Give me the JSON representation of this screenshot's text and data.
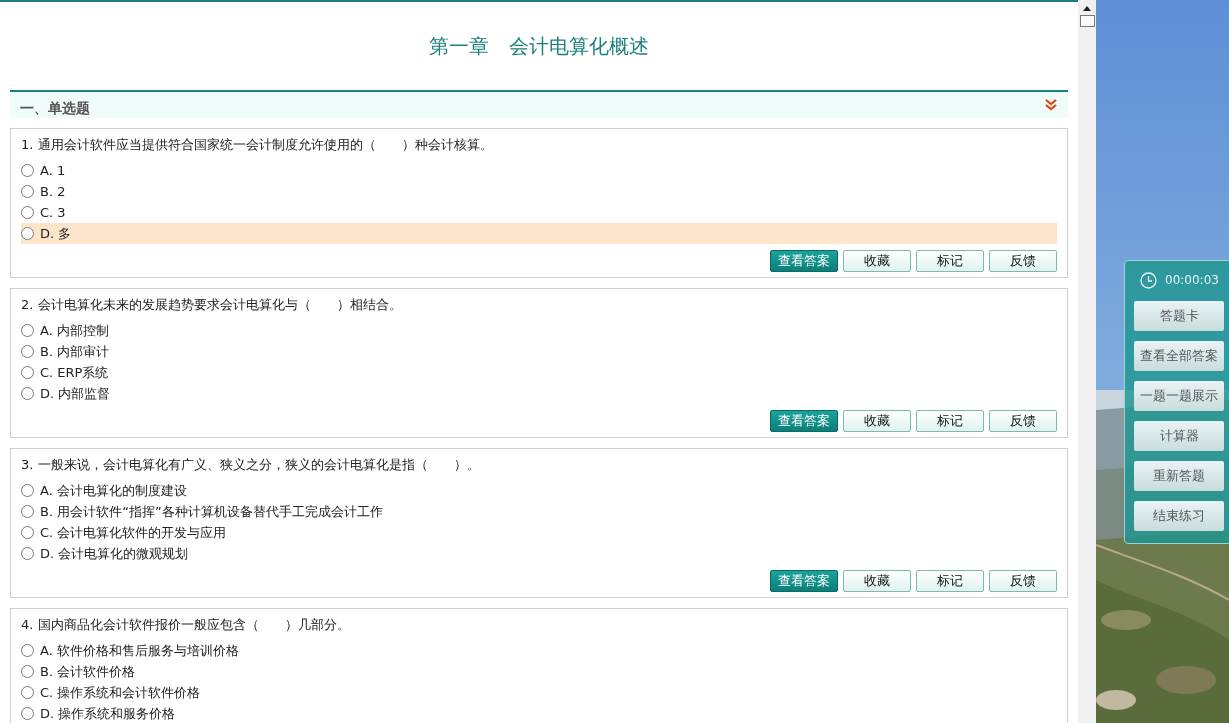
{
  "title": "第一章　会计电算化概述",
  "section": {
    "label": "一、单选题"
  },
  "questions": [
    {
      "text": "1. 通用会计软件应当提供符合国家统一会计制度允许使用的（　　）种会计核算。",
      "options": [
        {
          "label": "A. 1",
          "selected": false,
          "highlighted": false
        },
        {
          "label": "B. 2",
          "selected": false,
          "highlighted": false
        },
        {
          "label": "C. 3",
          "selected": false,
          "highlighted": false
        },
        {
          "label": "D. 多",
          "selected": false,
          "highlighted": true
        }
      ],
      "buttons": [
        {
          "label": "查看答案",
          "primary": true
        },
        {
          "label": "收藏",
          "primary": false
        },
        {
          "label": "标记",
          "primary": false
        },
        {
          "label": "反馈",
          "primary": false
        }
      ]
    },
    {
      "text": "2. 会计电算化未来的发展趋势要求会计电算化与（　　）相结合。",
      "options": [
        {
          "label": "A. 内部控制",
          "selected": false,
          "highlighted": false
        },
        {
          "label": "B. 内部审计",
          "selected": false,
          "highlighted": false
        },
        {
          "label": "C. ERP系统",
          "selected": false,
          "highlighted": false
        },
        {
          "label": "D. 内部监督",
          "selected": false,
          "highlighted": false
        }
      ],
      "buttons": [
        {
          "label": "查看答案",
          "primary": true
        },
        {
          "label": "收藏",
          "primary": false
        },
        {
          "label": "标记",
          "primary": false
        },
        {
          "label": "反馈",
          "primary": false
        }
      ]
    },
    {
      "text": "3. 一般来说，会计电算化有广义、狭义之分，狭义的会计电算化是指（　　）。",
      "options": [
        {
          "label": "A. 会计电算化的制度建设",
          "selected": false,
          "highlighted": false
        },
        {
          "label": "B. 用会计软件“指挥”各种计算机设备替代手工完成会计工作",
          "selected": false,
          "highlighted": false
        },
        {
          "label": "C. 会计电算化软件的开发与应用",
          "selected": false,
          "highlighted": false
        },
        {
          "label": "D. 会计电算化的微观规划",
          "selected": false,
          "highlighted": false
        }
      ],
      "buttons": [
        {
          "label": "查看答案",
          "primary": true
        },
        {
          "label": "收藏",
          "primary": false
        },
        {
          "label": "标记",
          "primary": false
        },
        {
          "label": "反馈",
          "primary": false
        }
      ]
    },
    {
      "text": "4. 国内商品化会计软件报价一般应包含（　　）几部分。",
      "options": [
        {
          "label": "A. 软件价格和售后服务与培训价格",
          "selected": false,
          "highlighted": false
        },
        {
          "label": "B. 会计软件价格",
          "selected": false,
          "highlighted": false
        },
        {
          "label": "C. 操作系统和会计软件价格",
          "selected": false,
          "highlighted": false
        },
        {
          "label": "D. 操作系统和服务价格",
          "selected": false,
          "highlighted": false
        }
      ]
    }
  ],
  "side_panel": {
    "timer": "00:00:03",
    "buttons": [
      "答题卡",
      "查看全部答案",
      "一题一题展示",
      "计算器",
      "重新答题",
      "结束练习"
    ]
  }
}
